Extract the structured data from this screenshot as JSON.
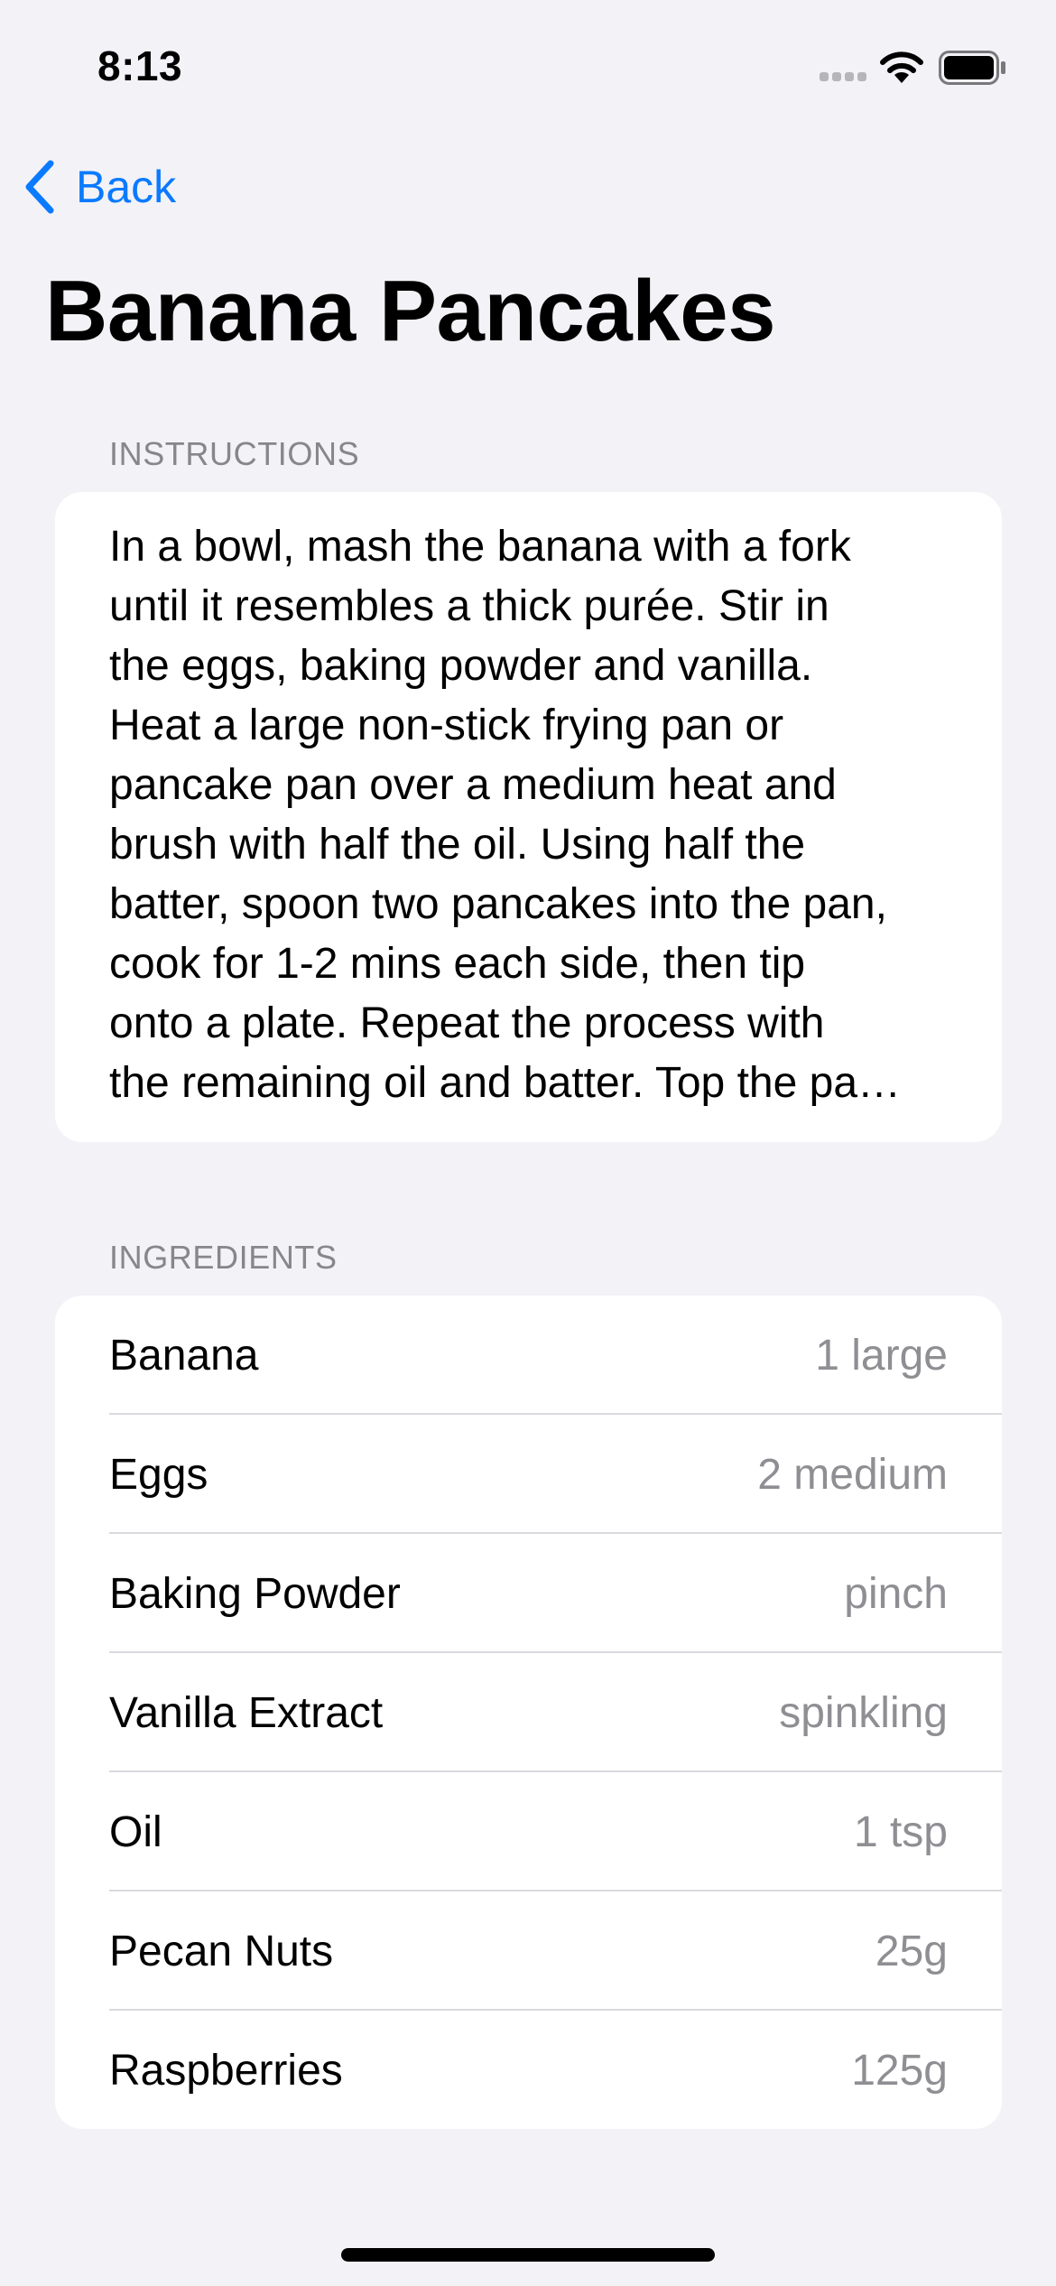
{
  "status_bar": {
    "time": "8:13"
  },
  "nav": {
    "back_label": "Back"
  },
  "page": {
    "title": "Banana Pancakes"
  },
  "instructions": {
    "header": "INSTRUCTIONS",
    "text": "In a bowl, mash the banana with a fork\nuntil it resembles a thick purée. Stir in\nthe eggs, baking powder and vanilla.\nHeat a large non-stick frying pan or\npancake pan over a medium heat and\nbrush with half the oil. Using half the\nbatter, spoon two pancakes into the pan,\ncook for 1-2 mins each side, then tip\nonto a plate. Repeat the process with\nthe remaining oil and batter. Top the pa…"
  },
  "ingredients": {
    "header": "INGREDIENTS",
    "items": [
      {
        "name": "Banana",
        "quantity": "1 large"
      },
      {
        "name": "Eggs",
        "quantity": "2 medium"
      },
      {
        "name": "Baking Powder",
        "quantity": "pinch"
      },
      {
        "name": "Vanilla Extract",
        "quantity": "spinkling"
      },
      {
        "name": "Oil",
        "quantity": "1 tsp"
      },
      {
        "name": "Pecan Nuts",
        "quantity": "25g"
      },
      {
        "name": "Raspberries",
        "quantity": "125g"
      }
    ]
  },
  "colors": {
    "accent": "#0a7aff",
    "background": "#f2f2f7",
    "secondary_text": "#8e8e93"
  },
  "icons": {
    "back": "chevron-left-icon",
    "signal": "cellular-signal-icon",
    "wifi": "wifi-icon",
    "battery": "battery-icon"
  }
}
